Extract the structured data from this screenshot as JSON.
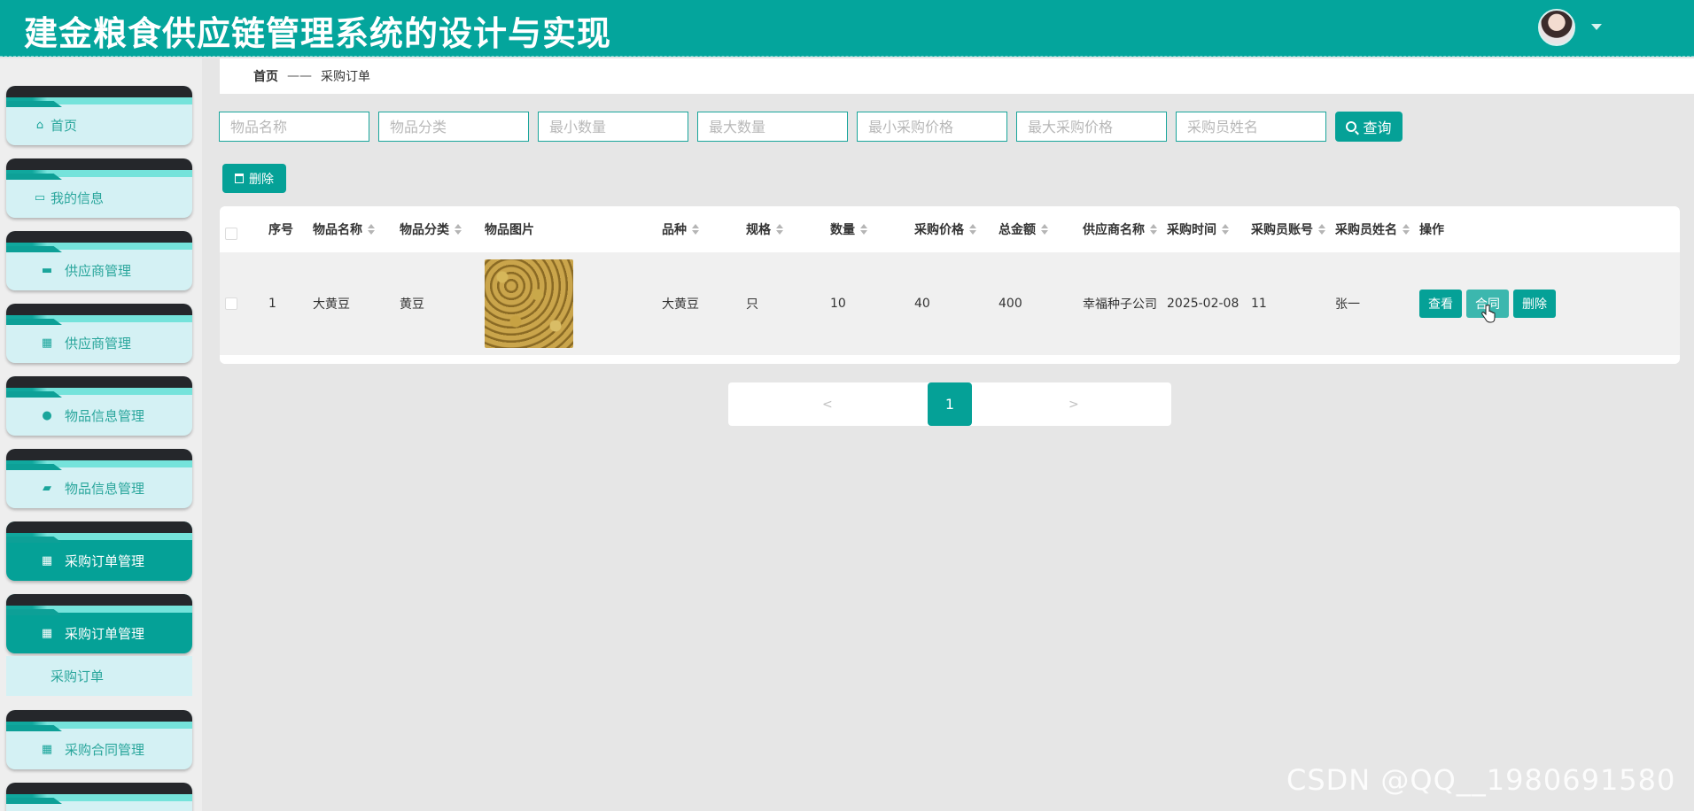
{
  "header": {
    "title": "建金粮食供应链管理系统的设计与实现"
  },
  "sidebar": {
    "items": [
      {
        "label": "首页",
        "icon": "home-icon"
      },
      {
        "label": "我的信息",
        "icon": "card-icon"
      },
      {
        "label": "供应商管理",
        "icon": "briefcase-icon"
      },
      {
        "label": "供应商管理",
        "icon": "grid-icon"
      },
      {
        "label": "物品信息管理",
        "icon": "user-icon"
      },
      {
        "label": "物品信息管理",
        "icon": "ticket-icon"
      },
      {
        "label": "采购订单管理",
        "icon": "grid-icon"
      },
      {
        "label": "采购订单管理",
        "icon": "grid-icon"
      },
      {
        "label": "采购合同管理",
        "icon": "grid-icon"
      }
    ],
    "submenu": {
      "label": "采购订单"
    }
  },
  "breadcrumb": {
    "home": "首页",
    "separator": "——",
    "current": "采购订单"
  },
  "search": {
    "placeholders": [
      "物品名称",
      "物品分类",
      "最小数量",
      "最大数量",
      "最小采购价格",
      "最大采购价格",
      "采购员姓名"
    ],
    "button_label": "查询"
  },
  "toolbar": {
    "delete_label": "删除"
  },
  "table": {
    "columns": [
      "序号",
      "物品名称",
      "物品分类",
      "物品图片",
      "品种",
      "规格",
      "数量",
      "采购价格",
      "总金额",
      "供应商名称",
      "采购时间",
      "采购员账号",
      "采购员姓名",
      "操作"
    ],
    "rows": [
      {
        "index": "1",
        "name": "大黄豆",
        "category": "黄豆",
        "variety": "大黄豆",
        "spec": "只",
        "quantity": "10",
        "price": "40",
        "total": "400",
        "supplier": "幸福种子公司",
        "time": "2025-02-08",
        "buyer_account": "11",
        "buyer_name": "张一"
      }
    ],
    "actions": {
      "view": "查看",
      "contract": "合同",
      "delete": "删除"
    }
  },
  "pagination": {
    "prev": "<",
    "current": "1",
    "next": ">"
  },
  "watermark": "CSDN @QQ__1980691580",
  "colors": {
    "primary": "#05a197",
    "header": "#04a59c",
    "menu_bg": "#d4f1f4"
  }
}
